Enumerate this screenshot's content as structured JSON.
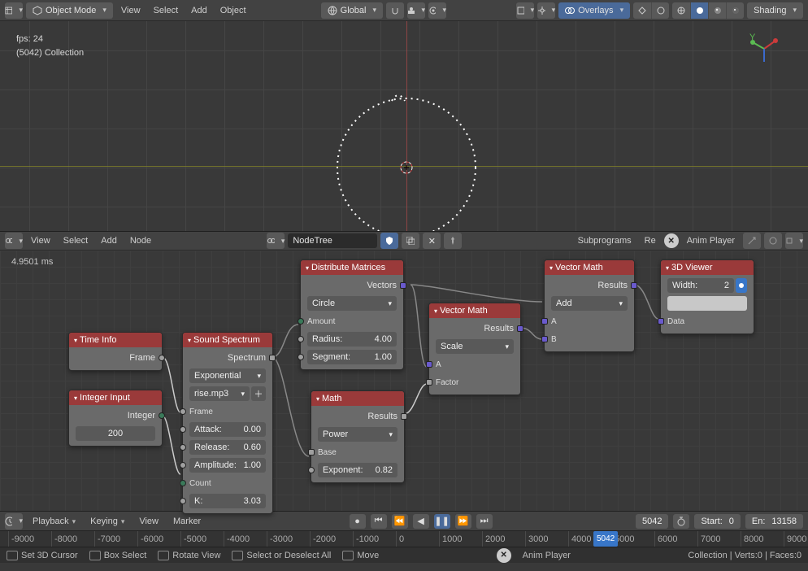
{
  "header3d": {
    "mode": "Object Mode",
    "menus": [
      "View",
      "Select",
      "Add",
      "Object"
    ],
    "orientation": "Global",
    "overlays": "Overlays",
    "shading": "Shading"
  },
  "viewport": {
    "fps": "fps: 24",
    "collection": "(5042) Collection"
  },
  "nodeHeader": {
    "menus": [
      "View",
      "Select",
      "Add",
      "Node"
    ],
    "tree_name": "NodeTree",
    "subprograms": "Subprograms",
    "remove_label": "Re",
    "anim_player": "Anim Player"
  },
  "nodeCanvas": {
    "ms": "4.9501 ms"
  },
  "nodes": {
    "timeinfo": {
      "title": "Time Info",
      "out": "Frame"
    },
    "intinput": {
      "title": "Integer Input",
      "out": "Integer",
      "val": "200"
    },
    "sound": {
      "title": "Sound Spectrum",
      "out": "Spectrum",
      "interp": "Exponential",
      "file": "rise.mp3",
      "frame": "Frame",
      "attack_l": "Attack:",
      "attack_v": "0.00",
      "release_l": "Release:",
      "release_v": "0.60",
      "amp_l": "Amplitude:",
      "amp_v": "1.00",
      "count": "Count",
      "k_l": "K:",
      "k_v": "3.03"
    },
    "dist": {
      "title": "Distribute Matrices",
      "out": "Vectors",
      "shape": "Circle",
      "amount": "Amount",
      "rad_l": "Radius:",
      "rad_v": "4.00",
      "seg_l": "Segment:",
      "seg_v": "1.00"
    },
    "math": {
      "title": "Math",
      "out": "Results",
      "op": "Power",
      "base": "Base",
      "exp_l": "Exponent:",
      "exp_v": "0.82"
    },
    "vmath1": {
      "title": "Vector Math",
      "out": "Results",
      "op": "Scale",
      "a": "A",
      "f": "Factor"
    },
    "vmath2": {
      "title": "Vector Math",
      "out": "Results",
      "op": "Add",
      "a": "A",
      "b": "B"
    },
    "viewer": {
      "title": "3D Viewer",
      "width_l": "Width:",
      "width_v": "2",
      "data": "Data"
    }
  },
  "timeline": {
    "menus": [
      "Playback",
      "Keying",
      "View",
      "Marker"
    ],
    "current": "5042",
    "start_l": "Start:",
    "start_v": "0",
    "end_l": "En:",
    "end_v": "13158",
    "ticks": [
      "-9000",
      "-8000",
      "-7000",
      "-6000",
      "-5000",
      "-4000",
      "-3000",
      "-2000",
      "-1000",
      "0",
      "1000",
      "2000",
      "3000",
      "4000",
      "5000",
      "6000",
      "7000",
      "8000",
      "9000"
    ],
    "playhead_label": "5042"
  },
  "status": {
    "items": [
      "Set 3D Cursor",
      "Box Select",
      "Rotate View",
      "Select or Deselect All",
      "Move"
    ],
    "anim_player": "Anim Player",
    "stats": "Collection | Verts:0 | Faces:0"
  }
}
